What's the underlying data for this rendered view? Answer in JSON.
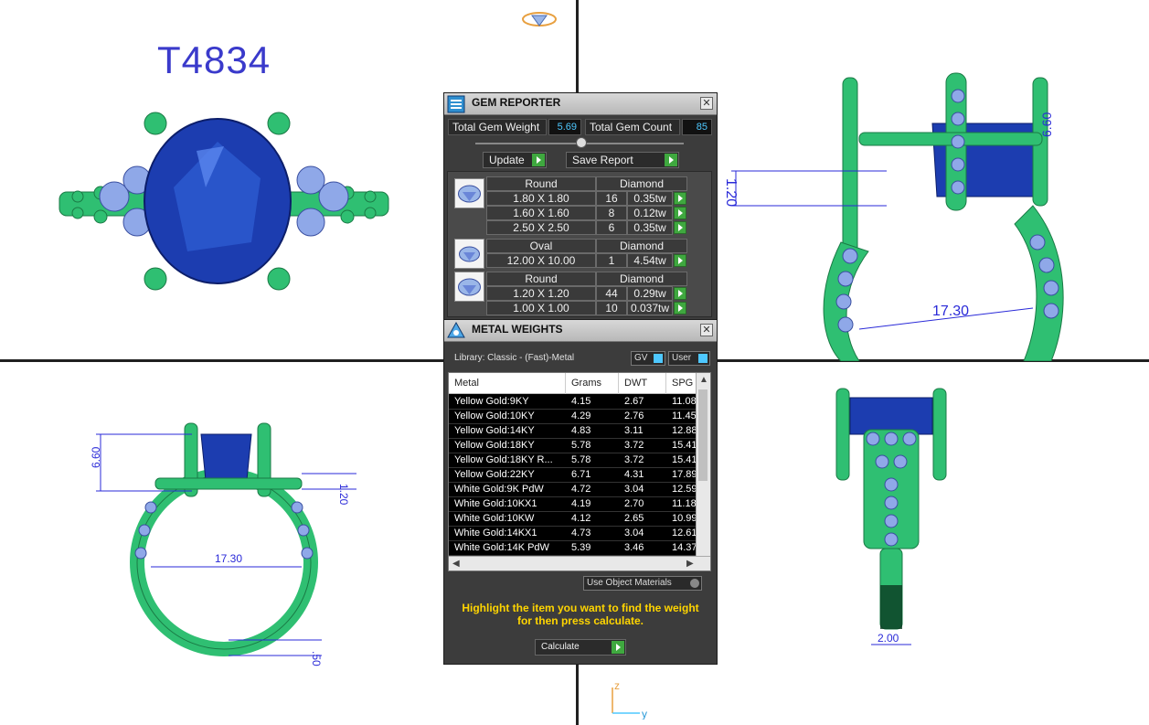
{
  "model_id": "T4834",
  "dims": {
    "top_right_height": "6.60",
    "top_right_gap": "1.20",
    "top_right_width": "17.30",
    "bottom_left_height": "6.60",
    "bottom_left_gap": "1.20",
    "bottom_left_width": "17.30",
    "bottom_left_band": ".50",
    "bottom_right_band": "2.00"
  },
  "axis": {
    "z": "z",
    "y": "y"
  },
  "colors": {
    "metal": "#2fbf72",
    "gem": "#1c3db0",
    "accent_stone": "#8fa8e8",
    "dim": "#2a2ad8",
    "panel": "#3c3c3c",
    "go_button": "#3fa83f",
    "value_text": "#4ec8ff",
    "hint": "#ffd500"
  },
  "gem_reporter": {
    "title": "GEM REPORTER",
    "icon": "gem-reporter-icon",
    "total_weight_label": "Total Gem Weight",
    "total_weight_value": "5.69",
    "total_count_label": "Total Gem Count",
    "total_count_value": "85",
    "update_label": "Update",
    "save_report_label": "Save Report",
    "groups": [
      {
        "shape": "Round",
        "material": "Diamond",
        "icon": "round-gem-icon",
        "rows": [
          {
            "size": "1.80 X 1.80",
            "count": "16",
            "weight": "0.35tw"
          },
          {
            "size": "1.60 X 1.60",
            "count": "8",
            "weight": "0.12tw"
          },
          {
            "size": "2.50 X 2.50",
            "count": "6",
            "weight": "0.35tw"
          }
        ]
      },
      {
        "shape": "Oval",
        "material": "Diamond",
        "icon": "oval-gem-icon",
        "rows": [
          {
            "size": "12.00 X 10.00",
            "count": "1",
            "weight": "4.54tw"
          }
        ]
      },
      {
        "shape": "Round",
        "material": "Diamond",
        "icon": "round-gem-icon",
        "rows": [
          {
            "size": "1.20 X 1.20",
            "count": "44",
            "weight": "0.29tw"
          },
          {
            "size": "1.00 X 1.00",
            "count": "10",
            "weight": "0.037tw"
          }
        ]
      }
    ]
  },
  "metal_weights": {
    "title": "METAL WEIGHTS",
    "icon": "metal-weights-icon",
    "library_label": "Library: Classic - (Fast)-Metal",
    "gv_label": "GV",
    "user_label": "User",
    "columns": [
      "Metal",
      "Grams",
      "DWT",
      "SPG"
    ],
    "rows": [
      [
        "Yellow Gold:9KY",
        "4.15",
        "2.67",
        "11.08"
      ],
      [
        "Yellow Gold:10KY",
        "4.29",
        "2.76",
        "11.45"
      ],
      [
        "Yellow Gold:14KY",
        "4.83",
        "3.11",
        "12.88"
      ],
      [
        "Yellow Gold:18KY",
        "5.78",
        "3.72",
        "15.41"
      ],
      [
        "Yellow Gold:18KY R...",
        "5.78",
        "3.72",
        "15.41"
      ],
      [
        "Yellow Gold:22KY",
        "6.71",
        "4.31",
        "17.89"
      ],
      [
        "White Gold:9K PdW",
        "4.72",
        "3.04",
        "12.59"
      ],
      [
        "White Gold:10KX1",
        "4.19",
        "2.70",
        "11.18"
      ],
      [
        "White Gold:10KW",
        "4.12",
        "2.65",
        "10.99"
      ],
      [
        "White Gold:14KX1",
        "4.73",
        "3.04",
        "12.61"
      ],
      [
        "White Gold:14K PdW",
        "5.39",
        "3.46",
        "14.37"
      ]
    ],
    "use_object_materials_label": "Use Object Materials",
    "hint_line1": "Highlight the item you want to find the weight",
    "hint_line2": "for then press calculate.",
    "calculate_label": "Calculate"
  }
}
